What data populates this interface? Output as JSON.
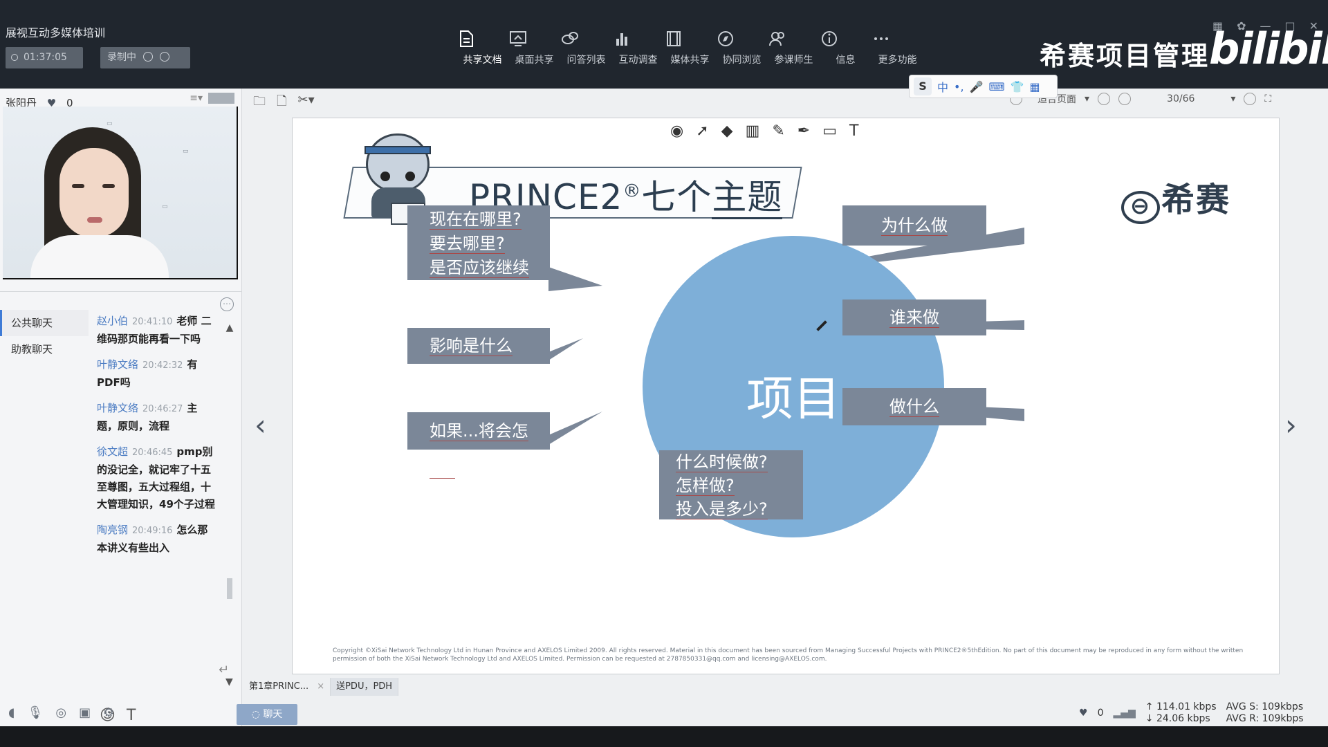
{
  "window": {
    "app_title": "展视互动多媒体培训",
    "timer": "01:37:05",
    "record_label": "录制中",
    "brand_text": "希赛项目管理",
    "brand_logo": "bilibili"
  },
  "toolbar": {
    "items": [
      {
        "label": "共享文档",
        "icon": "document-icon",
        "active": true
      },
      {
        "label": "桌面共享",
        "icon": "desktop-share-icon"
      },
      {
        "label": "问答列表",
        "icon": "qa-icon"
      },
      {
        "label": "互动调查",
        "icon": "poll-icon"
      },
      {
        "label": "媒体共享",
        "icon": "media-icon"
      },
      {
        "label": "协同浏览",
        "icon": "compass-icon"
      },
      {
        "label": "参课师生",
        "icon": "users-icon"
      },
      {
        "label": "信息",
        "icon": "info-icon"
      },
      {
        "label": "更多功能",
        "icon": "more-icon"
      }
    ]
  },
  "presenter": {
    "name": "张阳丹",
    "likes": "0"
  },
  "chat": {
    "tabs": [
      "公共聊天",
      "助教聊天"
    ],
    "messages": [
      {
        "user": "赵小伯",
        "time": "20:41:10",
        "text": "老师 二维码那页能再看一下吗"
      },
      {
        "user": "叶静文络",
        "time": "20:42:32",
        "text": "有PDF吗"
      },
      {
        "user": "叶静文络",
        "time": "20:46:27",
        "text": "主题，原则，流程"
      },
      {
        "user": "徐文超",
        "time": "20:46:45",
        "text": "pmp别的没记全，就记牢了十五至尊图，五大过程组，十大管理知识，49个子过程"
      },
      {
        "user": "陶亮钢",
        "time": "20:49:16",
        "text": "怎么那本讲义有些出入"
      }
    ],
    "send_label": "聊天"
  },
  "doc": {
    "fit_label": "适合页面",
    "page_indicator": "30/66",
    "tabs": [
      "第1章PRINC...",
      "送PDU，PDH"
    ]
  },
  "ime": {
    "lang": "中"
  },
  "slide": {
    "title_prefix": "PRINCE2",
    "title_reg": "®",
    "title_mid": "七个",
    "title_underlined": "主题",
    "logo_text": "希赛",
    "center_label": "项目",
    "boxes": {
      "left_top": [
        "现在在哪里?",
        "要去哪里?",
        "是否应该继续"
      ],
      "left_mid": [
        "影响是什么"
      ],
      "left_bottom": [
        "如果...将会怎样?"
      ],
      "right_top": [
        "为什么做"
      ],
      "right_mid": [
        "谁来做"
      ],
      "right_bottom": [
        "做什么"
      ],
      "bottom": [
        "什么时候做?",
        "怎样做?",
        "投入是多少?"
      ]
    },
    "copyright": "Copyright ©XiSai Network Technology Ltd in Hunan Province and AXELOS Limited 2009. All rights reserved. Material in this document has been sourced from Managing Successful Projects with PRINCE2®5thEdition. No part of this document may be reproduced in any form without the written permission of both the XiSai Network Technology Ltd and AXELOS Limited. Permission can be requested at 2787850331@qq.com and licensing@AXELOS.com."
  },
  "network": {
    "likes": "0",
    "up_rate": "114.01 kbps",
    "down_rate": "24.06 kbps",
    "avg_s": "AVG S: 109kbps",
    "avg_r": "AVG R: 109kbps"
  },
  "colors": {
    "topbar": "#20262e",
    "circle": "#7eafd8",
    "box": "#7b8798",
    "accent": "#3e7bd6"
  }
}
